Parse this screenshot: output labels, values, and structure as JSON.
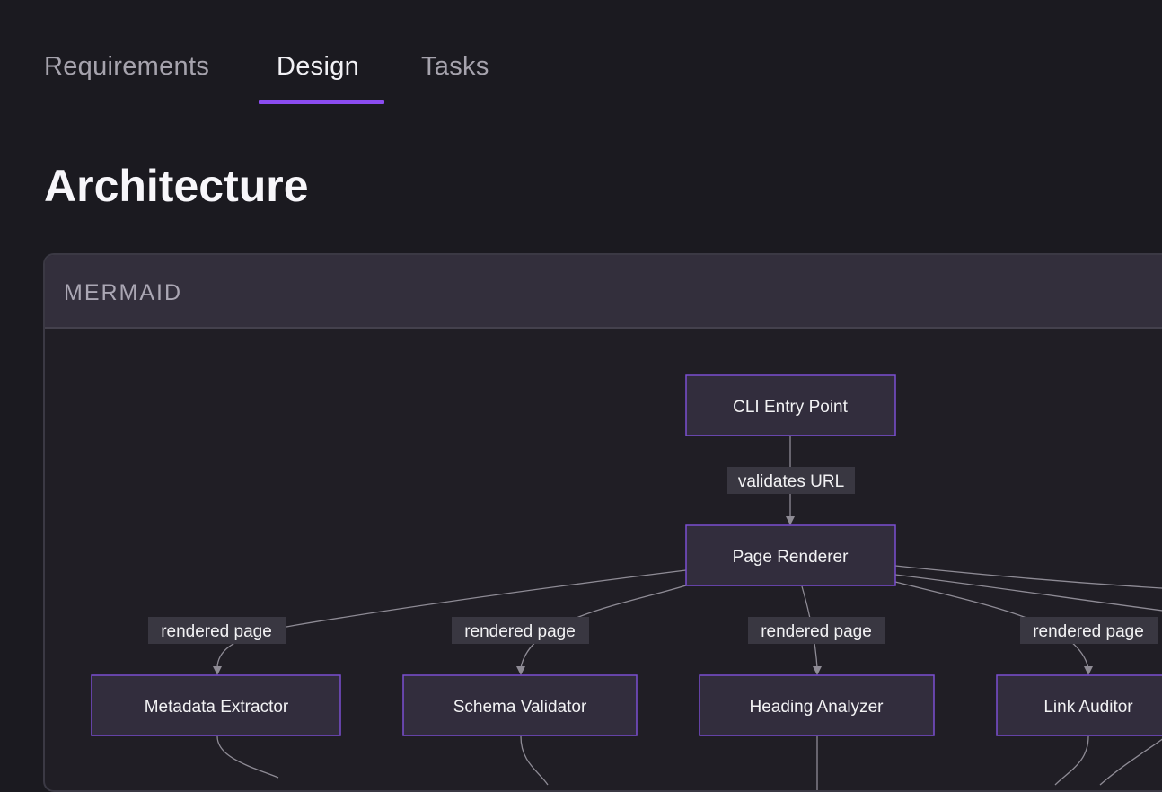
{
  "tabs": [
    {
      "label": "Requirements",
      "active": false
    },
    {
      "label": "Design",
      "active": true
    },
    {
      "label": "Tasks",
      "active": false
    }
  ],
  "accent_color": "#8b4cf0",
  "page_title": "Architecture",
  "panel": {
    "label": "MERMAID",
    "diagram": {
      "nodes": {
        "cli": "CLI Entry Point",
        "renderer": "Page Renderer",
        "metadata": "Metadata Extractor",
        "schema": "Schema Validator",
        "heading": "Heading Analyzer",
        "links": "Link Auditor"
      },
      "edges": {
        "cli_to_renderer": "validates URL",
        "renderer_to_metadata": "rendered page",
        "renderer_to_schema": "rendered page",
        "renderer_to_heading": "rendered page",
        "renderer_to_links": "rendered page"
      }
    }
  }
}
